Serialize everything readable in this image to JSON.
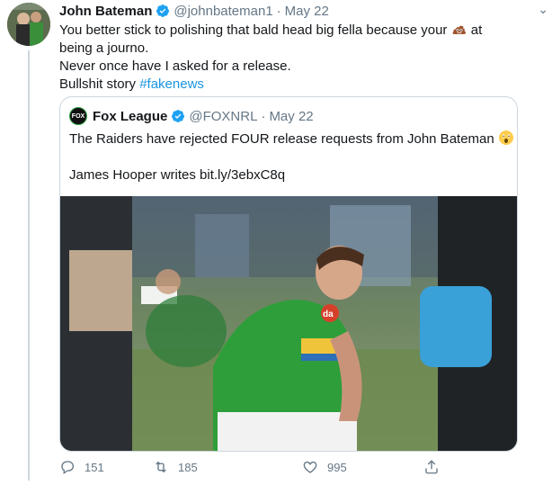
{
  "tweet": {
    "author_name": "John Bateman",
    "handle": "@johnbateman1",
    "separator": "·",
    "date": "May 22",
    "lines": [
      "You better stick to polishing that bald head big fella because your",
      "at",
      "being a journo.",
      "Never once have I asked for a release.",
      "Bullshit story"
    ],
    "hashtag": "#fakenews",
    "emoji_icon": "pile-of-poo-emoji"
  },
  "quote": {
    "author_name": "Fox League",
    "avatar_text": "FOX",
    "handle": "@FOXNRL",
    "separator": "·",
    "date": "May 22",
    "line1": "The Raiders have rejected FOUR release requests from John Bateman",
    "line2": "James Hooper writes bit.ly/3ebxC8q",
    "emoji_icon": "astonished-face-emoji",
    "image": {
      "description_icon": "player-photo",
      "jersey_text": "da"
    }
  },
  "actions": {
    "reply_count": "151",
    "retweet_count": "185",
    "like_count": "995"
  },
  "colors": {
    "link": "#1b95e0",
    "muted": "#657786",
    "verified": "#1da1f2",
    "raiders_green": "#2e9e3a"
  }
}
